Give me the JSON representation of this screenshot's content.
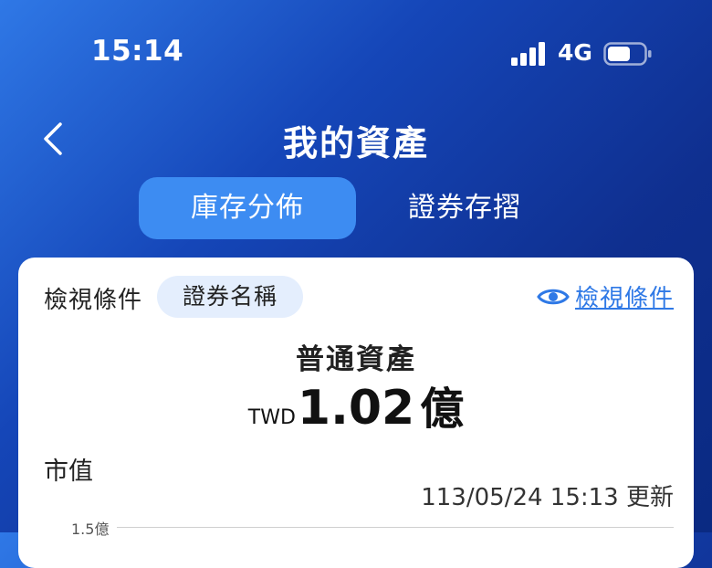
{
  "status_bar": {
    "time": "15:14",
    "network": "4G",
    "icons": [
      "signal-bars-icon",
      "battery-icon"
    ]
  },
  "header": {
    "title": "我的資產",
    "back_icon": "chevron-left-icon"
  },
  "tabs": [
    {
      "label": "庫存分佈",
      "active": true
    },
    {
      "label": "證券存摺",
      "active": false
    }
  ],
  "card": {
    "filter_label": "檢視條件",
    "filter_chip": "證券名稱",
    "view_link": "檢視條件",
    "view_icon": "eye-icon",
    "asset_title": "普通資產",
    "currency": "TWD",
    "amount": "1.02",
    "unit": "億",
    "market_label": "市值",
    "update_time": "113/05/24 15:13 更新",
    "axis_tick": "1.5億"
  },
  "colors": {
    "accent": "#3d8cf2",
    "link": "#2f79e6",
    "chip_bg": "#e4eefd",
    "header_bg": "#0f2f8f"
  }
}
